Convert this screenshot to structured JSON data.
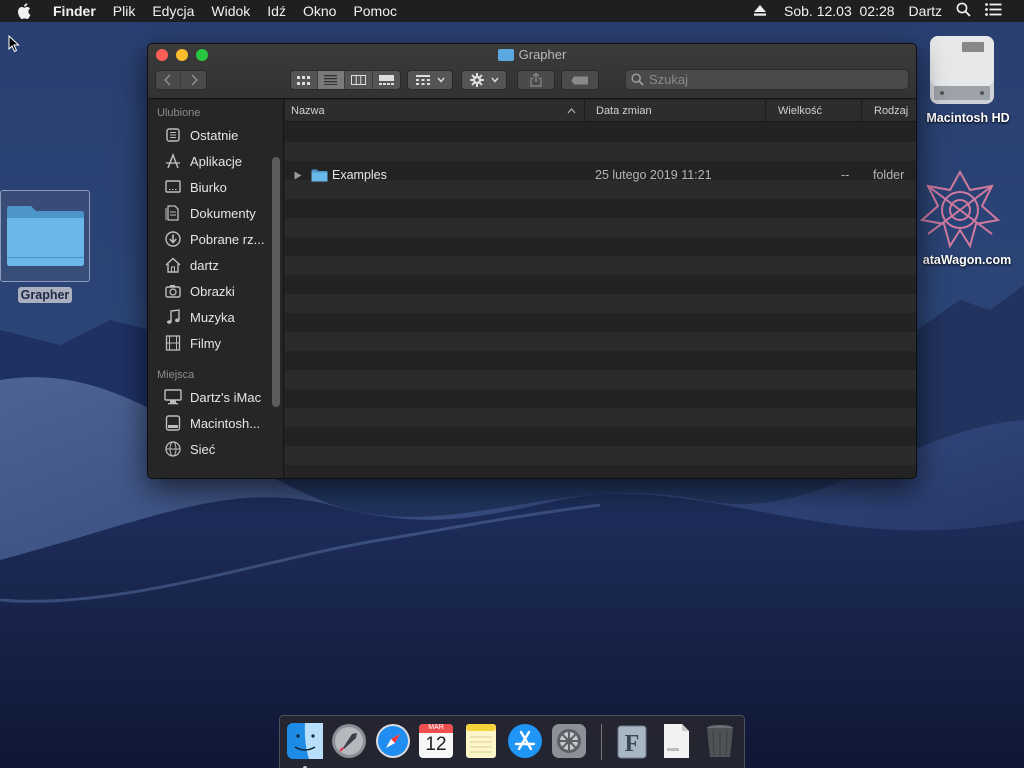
{
  "menubar": {
    "app_name": "Finder",
    "menus": [
      "Plik",
      "Edycja",
      "Widok",
      "Idź",
      "Okno",
      "Pomoc"
    ],
    "datetime": "Sob. 12.03  02:28",
    "user": "Dartz"
  },
  "desktop": {
    "folder_label": "Grapher",
    "hd_label": "Macintosh HD",
    "datawagon_label": "ataWagon.com"
  },
  "window": {
    "title": "Grapher",
    "search_placeholder": "Szukaj",
    "sidebar": {
      "favorites_header": "Ulubione",
      "favorites": [
        {
          "label": "Ostatnie",
          "icon": "recents-icon"
        },
        {
          "label": "Aplikacje",
          "icon": "applications-icon"
        },
        {
          "label": "Biurko",
          "icon": "desktop-icon"
        },
        {
          "label": "Dokumenty",
          "icon": "documents-icon"
        },
        {
          "label": "Pobrane rz...",
          "icon": "downloads-icon"
        },
        {
          "label": "dartz",
          "icon": "home-icon"
        },
        {
          "label": "Obrazki",
          "icon": "camera-icon"
        },
        {
          "label": "Muzyka",
          "icon": "music-note-icon"
        },
        {
          "label": "Filmy",
          "icon": "film-icon"
        }
      ],
      "places_header": "Miejsca",
      "places": [
        {
          "label": "Dartz's iMac",
          "icon": "computer-icon"
        },
        {
          "label": "Macintosh...",
          "icon": "hard-disk-icon"
        },
        {
          "label": "Sieć",
          "icon": "network-icon"
        }
      ]
    },
    "columns": {
      "name": "Nazwa",
      "date": "Data zmian",
      "size": "Wielkość",
      "kind": "Rodzaj"
    },
    "rows": [
      {
        "name": "Examples",
        "date": "25 lutego 2019 11:21",
        "size": "--",
        "kind": "folder"
      }
    ]
  },
  "dock": {
    "calendar_month": "MAR",
    "calendar_day": "12"
  },
  "colors": {
    "close": "#fc5f57",
    "minimize": "#fdbc2e",
    "maximize": "#27c840",
    "folder_blue": "#5aa8e0"
  }
}
